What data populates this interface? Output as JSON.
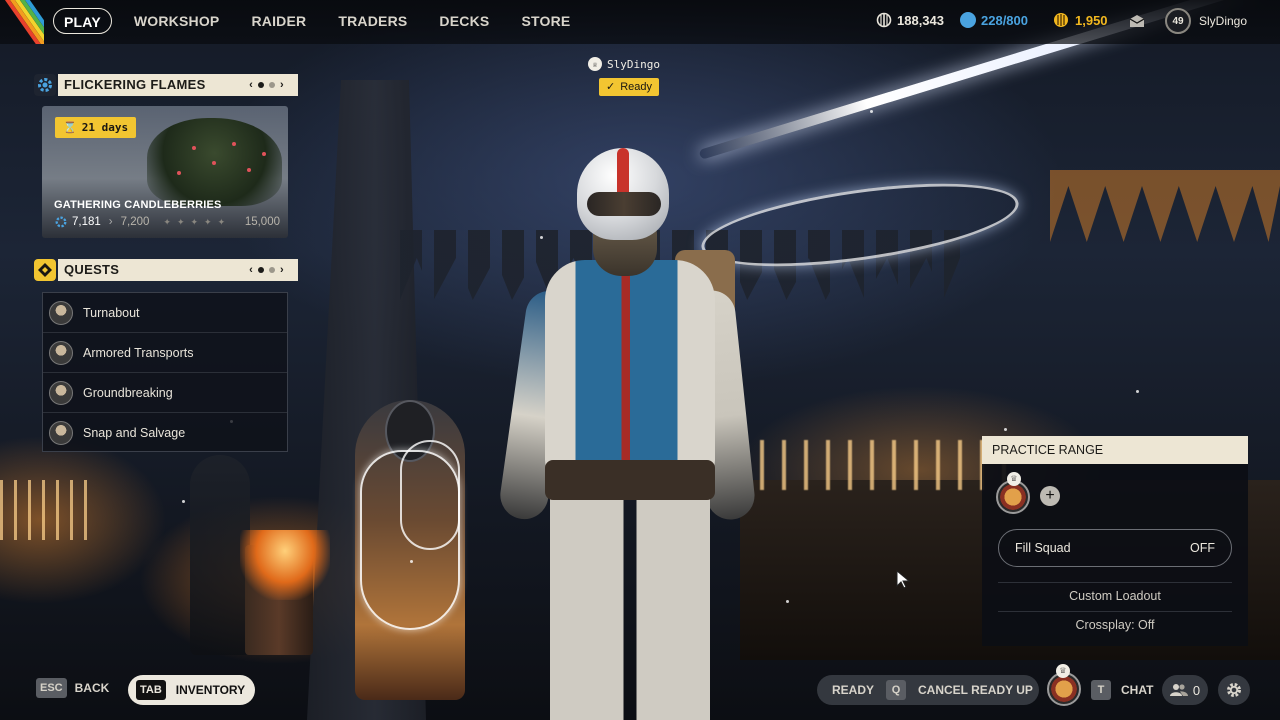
{
  "nav": {
    "items": [
      "PLAY",
      "WORKSHOP",
      "RAIDER",
      "TRADERS",
      "DECKS",
      "STORE"
    ],
    "active": "PLAY"
  },
  "currencies": [
    {
      "icon": "coins-icon",
      "value": "188,343"
    },
    {
      "icon": "raider-token-icon",
      "value": "228/800"
    },
    {
      "icon": "premium-currency-icon",
      "value": "1,950"
    }
  ],
  "profile": {
    "level": "49",
    "name": "SlyDingo"
  },
  "event": {
    "panel_title": "FLICKERING FLAMES",
    "timer": "21 days",
    "title": "GATHERING CANDLEBERRIES",
    "progress_current": "7,181",
    "progress_next": "7,200",
    "progress_max": "15,000"
  },
  "quests": {
    "panel_title": "QUESTS",
    "items": [
      "Turnabout",
      "Armored Transports",
      "Groundbreaking",
      "Snap and Salvage"
    ]
  },
  "player_tag": {
    "name": "SlyDingo",
    "status": "Ready"
  },
  "practice_range": {
    "title": "PRACTICE RANGE",
    "fill_squad_label": "Fill Squad",
    "fill_squad_value": "OFF",
    "custom_loadout": "Custom Loadout",
    "crossplay": "Crossplay: Off"
  },
  "bottom": {
    "esc_key": "ESC",
    "back_label": "BACK",
    "tab_key": "TAB",
    "inventory_label": "INVENTORY",
    "ready_label": "READY",
    "cancel_key": "Q",
    "cancel_label": "CANCEL READY UP",
    "chat_key": "T",
    "chat_label": "CHAT",
    "friends_count": "0"
  },
  "colors": {
    "accent_yellow": "#f2c531",
    "panel_cream": "#ede6d4",
    "currency_blue": "#4aa3e0",
    "currency_gold": "#f2b81f"
  }
}
